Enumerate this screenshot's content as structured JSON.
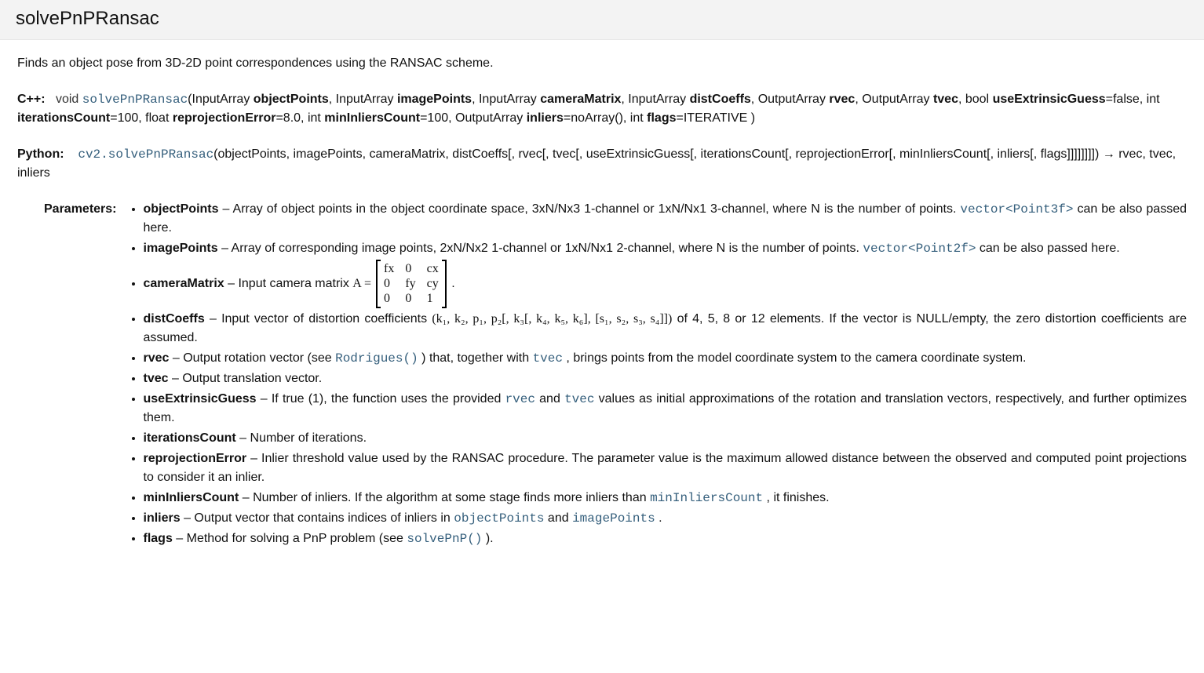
{
  "header": {
    "title": "solvePnPRansac"
  },
  "summary": "Finds an object pose from 3D-2D point correspondences using the RANSAC scheme.",
  "cpp": {
    "lang_label": "C++:",
    "ret": "void",
    "fname": "solvePnPRansac",
    "p1_type": "InputArray",
    "p1_name": "objectPoints",
    "p2_type": "InputArray",
    "p2_name": "imagePoints",
    "p3_type": "InputArray",
    "p3_name": "cameraMatrix",
    "p4_type": "InputArray",
    "p4_name": "distCoeffs",
    "p5_type": "OutputArray",
    "p5_name": "rvec",
    "p6_type": "OutputArray",
    "p6_name": "tvec",
    "p7_type": "bool",
    "p7_name": "useExtrinsicGuess",
    "p7_def": "=false",
    "p8_type": "int",
    "p8_name": "iterationsCount",
    "p8_def": "=100",
    "p9_type": "float",
    "p9_name": "reprojectionError",
    "p9_def": "=8.0",
    "p10_type": "int",
    "p10_name": "minInliersCount",
    "p10_def": "=100",
    "p11_type": "OutputArray",
    "p11_name": "inliers",
    "p11_def": "=noArray()",
    "p12_type": "int",
    "p12_name": "flags",
    "p12_def": "=ITERATIVE",
    "close": " )"
  },
  "python": {
    "lang_label": "Python:",
    "mod": "cv2.",
    "fname": "solvePnPRansac",
    "args_a": "(objectPoints, imagePoints, cameraMatrix, distCoeffs",
    "args_b": "[, rvec[, tvec[, useExtrinsicGuess[, iterationsCount[, reprojectionError[, minInliersCount[, inliers[, flags]]]]]]]]",
    "ret": ") → rvec, tvec, inliers"
  },
  "params_label": "Parameters:",
  "params": {
    "objectPoints_name": "objectPoints",
    "objectPoints_a": " – Array of object points in the object coordinate space, 3xN/Nx3 1-channel or 1xN/Nx1 3-channel, where N is the number of points. ",
    "objectPoints_code": "vector<Point3f>",
    "objectPoints_b": " can be also passed here.",
    "imagePoints_name": "imagePoints",
    "imagePoints_a": " – Array of corresponding image points, 2xN/Nx2 1-channel or 1xN/Nx1 2-channel, where N is the number of points. ",
    "imagePoints_code": "vector<Point2f>",
    "imagePoints_b": " can be also passed here.",
    "cameraMatrix_name": "cameraMatrix",
    "cameraMatrix_a": " – Input camera matrix ",
    "cameraMatrix_eq": "A = ",
    "cameraMatrix_m": {
      "r0c0": "fx",
      "r0c1": "0",
      "r0c2": "cx",
      "r1c0": "0",
      "r1c1": "fy",
      "r1c2": "cy",
      "r2c0": "0",
      "r2c1": "0",
      "r2c2": "1"
    },
    "cameraMatrix_b": " .",
    "distCoeffs_name": "distCoeffs",
    "distCoeffs_a": " – Input vector of distortion coefficients ",
    "distCoeffs_math": "(k₁, k₂, p₁, p₂[, k₃[, k₄, k₅, k₆], [s₁, s₂, s₃, s₄]])",
    "distCoeffs_b": " of 4, 5, 8 or 12 elements. If the vector is NULL/empty, the zero distortion coefficients are assumed.",
    "rvec_name": "rvec",
    "rvec_a": " – Output rotation vector (see ",
    "rvec_code": "Rodrigues()",
    "rvec_b": " ) that, together with ",
    "rvec_code2": "tvec",
    "rvec_c": " , brings points from the model coordinate system to the camera coordinate system.",
    "tvec_name": "tvec",
    "tvec_a": " – Output translation vector.",
    "useExtrinsicGuess_name": "useExtrinsicGuess",
    "useExtrinsicGuess_a": " – If true (1), the function uses the provided ",
    "useExtrinsicGuess_code1": "rvec",
    "useExtrinsicGuess_b": " and ",
    "useExtrinsicGuess_code2": "tvec",
    "useExtrinsicGuess_c": " values as initial approximations of the rotation and translation vectors, respectively, and further optimizes them.",
    "iterationsCount_name": "iterationsCount",
    "iterationsCount_a": " – Number of iterations.",
    "reprojectionError_name": "reprojectionError",
    "reprojectionError_a": " – Inlier threshold value used by the RANSAC procedure. The parameter value is the maximum allowed distance between the observed and computed point projections to consider it an inlier.",
    "minInliersCount_name": "minInliersCount",
    "minInliersCount_a": " – Number of inliers. If the algorithm at some stage finds more inliers than ",
    "minInliersCount_code": "minInliersCount",
    "minInliersCount_b": " , it finishes.",
    "inliers_name": "inliers",
    "inliers_a": " – Output vector that contains indices of inliers in ",
    "inliers_code1": "objectPoints",
    "inliers_b": " and ",
    "inliers_code2": "imagePoints",
    "inliers_c": " .",
    "flags_name": "flags",
    "flags_a": " – Method for solving a PnP problem (see ",
    "flags_code": "solvePnP()",
    "flags_b": " )."
  }
}
